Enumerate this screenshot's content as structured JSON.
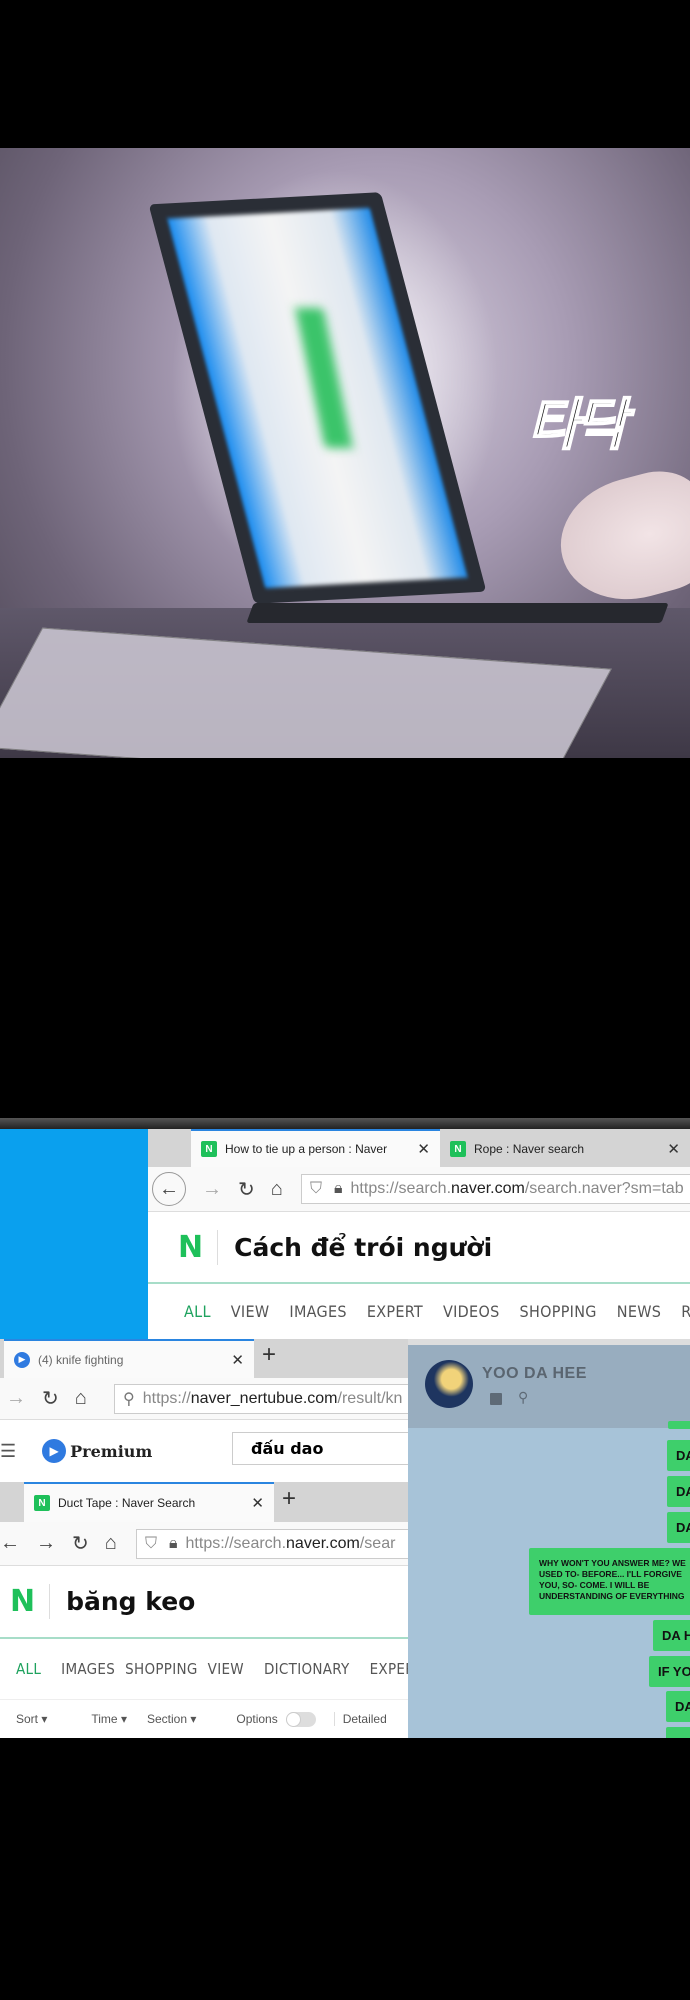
{
  "panel1": {
    "sfx": "타닥"
  },
  "browser1": {
    "tabs": [
      {
        "label": "How to tie up a person : Naver",
        "icon": "naver-n-icon"
      },
      {
        "label": "Rope : Naver search",
        "icon": "naver-n-icon"
      }
    ],
    "url_prefix": "https://search.",
    "url_domain": "naver.com",
    "url_suffix": "/search.naver?sm=tab",
    "logo": "N",
    "query": "Cách để trói người",
    "nav": [
      "ALL",
      "VIEW",
      "IMAGES",
      "EXPERT",
      "VIDEOS",
      "SHOPPING",
      "NEWS",
      "REAL"
    ]
  },
  "browser2": {
    "tab": "(4) knife fighting",
    "url_prefix": "https://",
    "url_domain": "naver_nertubue.com",
    "url_suffix": "/result/kn",
    "brand": "Premium",
    "query": "đấu dao"
  },
  "browser3": {
    "tab": "Duct Tape : Naver Search",
    "url_prefix": "https://search.",
    "url_domain": "naver.com",
    "url_suffix": "/sear",
    "logo": "N",
    "query": "băng keo",
    "nav": [
      "ALL",
      "IMAGES",
      "SHOPPING",
      "VIEW",
      "DICTIONARY",
      "EXPER"
    ],
    "filters": [
      "Sort",
      "Time",
      "Section",
      "Options",
      "Detailed"
    ]
  },
  "chat": {
    "name": "YOO DA HEE",
    "messages": [
      "DA",
      "DA",
      "DA",
      "WHY WON'T YOU ANSWER ME? WE USED TO- BEFORE... I'LL FORGIVE YOU, SO- COME. I WILL BE UNDERSTANDING OF EVERYTHING",
      "DA HE",
      "IF YOU",
      "DA"
    ]
  },
  "colors": {
    "naver_green": "#1ec05a",
    "bubble_green": "#3ecf6b",
    "chat_bg": "#a7c3d8",
    "desktop_blue": "#0aa0ee"
  }
}
